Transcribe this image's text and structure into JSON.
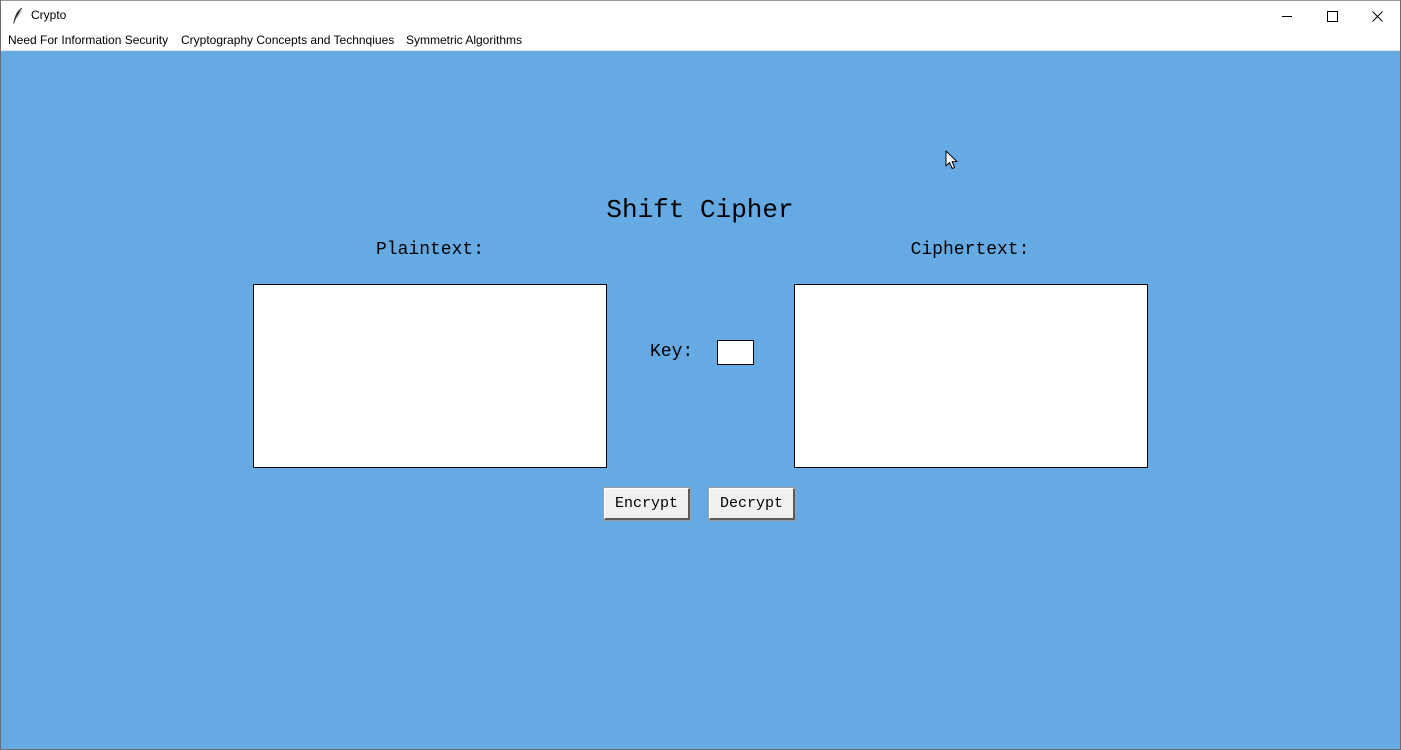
{
  "window": {
    "title": "Crypto",
    "app_icon": "feather-icon",
    "controls": [
      "minimize-icon",
      "maximize-icon",
      "close-icon"
    ]
  },
  "menubar": {
    "items": [
      {
        "label": "Need For Information Security"
      },
      {
        "label": "Cryptography Concepts and Technqiues"
      },
      {
        "label": "Symmetric Algorithms"
      }
    ]
  },
  "main": {
    "heading": "Shift Cipher",
    "plaintext_label": "Plaintext:",
    "plaintext_value": "",
    "ciphertext_label": "Ciphertext:",
    "ciphertext_value": "",
    "key_label": "Key:",
    "key_value": "",
    "encrypt_label": "Encrypt",
    "decrypt_label": "Decrypt"
  },
  "colors": {
    "background": "#66aae4",
    "chrome": "#ffffff",
    "button_face": "#f0f0f0"
  }
}
